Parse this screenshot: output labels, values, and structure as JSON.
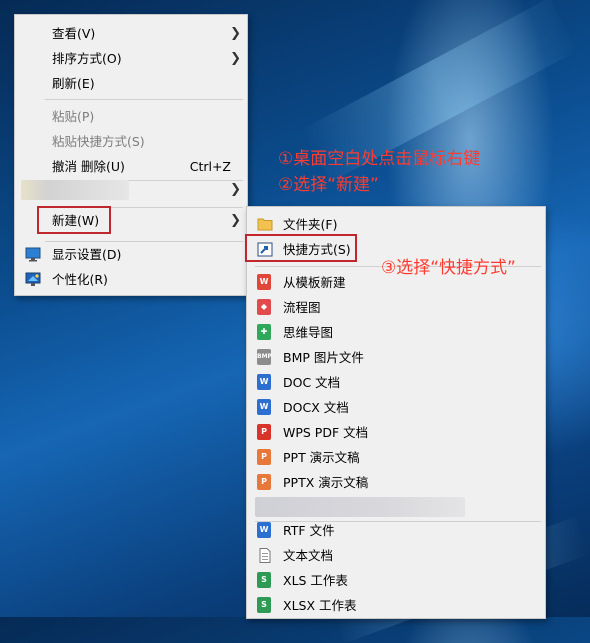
{
  "context_menu": {
    "items": [
      {
        "label": "查看(V)"
      },
      {
        "label": "排序方式(O)"
      },
      {
        "label": "刷新(E)"
      },
      {
        "label": "粘贴(P)"
      },
      {
        "label": "粘贴快捷方式(S)"
      },
      {
        "label": "撤消 删除(U)",
        "shortcut": "Ctrl+Z"
      },
      {
        "label": "新建(W)"
      },
      {
        "label": "显示设置(D)"
      },
      {
        "label": "个性化(R)"
      }
    ]
  },
  "new_submenu": {
    "items": [
      {
        "label": "文件夹(F)"
      },
      {
        "label": "快捷方式(S)"
      },
      {
        "label": "从模板新建"
      },
      {
        "label": "流程图"
      },
      {
        "label": "思维导图"
      },
      {
        "label": "BMP 图片文件"
      },
      {
        "label": "DOC 文档"
      },
      {
        "label": "DOCX 文档"
      },
      {
        "label": "WPS PDF 文档"
      },
      {
        "label": "PPT 演示文稿"
      },
      {
        "label": "PPTX 演示文稿"
      },
      {
        "label": "RTF 文件"
      },
      {
        "label": "文本文档"
      },
      {
        "label": "XLS 工作表"
      },
      {
        "label": "XLSX 工作表"
      }
    ]
  },
  "annotations": {
    "step1": "①桌面空白处点击鼠标右键",
    "step2": "②选择“新建”",
    "step3": "③选择“快捷方式”"
  },
  "colors": {
    "annotation_red": "#ff3b30",
    "highlight_box": "#c0262d",
    "menu_bg": "#f0f0f0"
  }
}
